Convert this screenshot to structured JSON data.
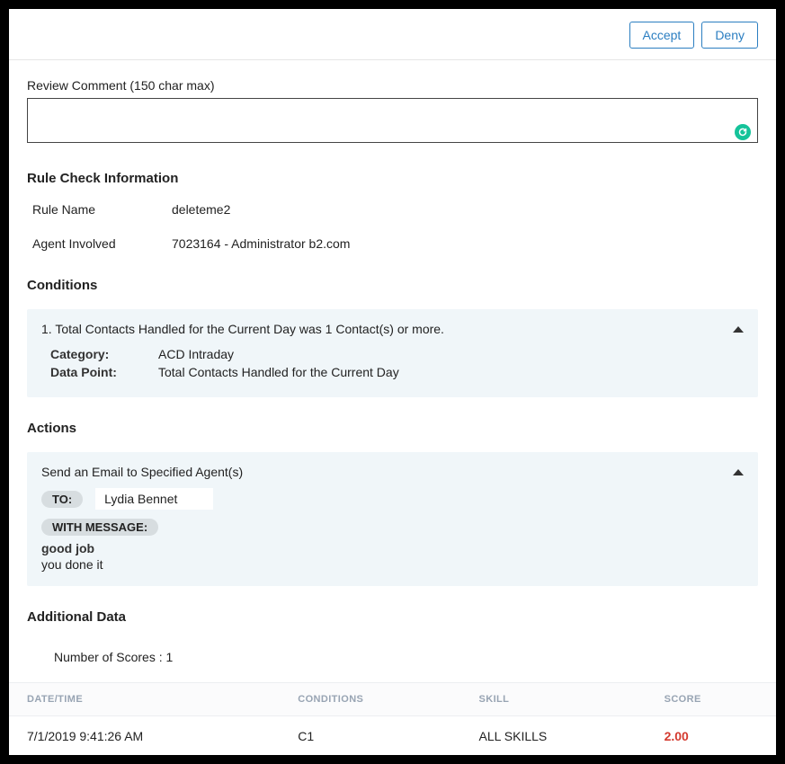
{
  "header": {
    "accept_label": "Accept",
    "deny_label": "Deny"
  },
  "review": {
    "label": "Review Comment (150 char max)",
    "value": ""
  },
  "rule_info": {
    "title": "Rule Check Information",
    "rows": [
      {
        "key": "Rule Name",
        "val": "deleteme2"
      },
      {
        "key": "Agent Involved",
        "val": "7023164 - Administrator b2.com"
      }
    ]
  },
  "conditions": {
    "title": "Conditions",
    "header_text": "1. Total Contacts Handled for the Current Day was 1 Contact(s) or more.",
    "category_label": "Category:",
    "category_value": "ACD Intraday",
    "datapoint_label": "Data Point:",
    "datapoint_value": "Total Contacts Handled for the Current Day"
  },
  "actions": {
    "title": "Actions",
    "header_text": "Send an Email to Specified Agent(s)",
    "to_label": "TO:",
    "recipient": "Lydia Bennet",
    "with_message_label": "WITH MESSAGE:",
    "message_subject": "good job",
    "message_body": "you done it"
  },
  "additional": {
    "title": "Additional Data",
    "scores_line": "Number of Scores : 1"
  },
  "table": {
    "headers": {
      "datetime": "DATE/TIME",
      "conditions": "CONDITIONS",
      "skill": "SKILL",
      "score": "SCORE"
    },
    "rows": [
      {
        "datetime": "7/1/2019 9:41:26 AM",
        "conditions": "C1",
        "skill": "ALL SKILLS",
        "score": "2.00"
      }
    ]
  }
}
